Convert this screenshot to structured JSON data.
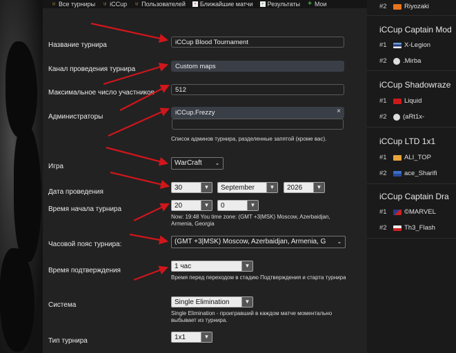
{
  "nav": [
    {
      "label": "Все турниры",
      "icon": "trophy-icon"
    },
    {
      "label": "iCCup",
      "icon": "trophy-icon"
    },
    {
      "label": "Пользователей",
      "icon": "trophy-icon"
    },
    {
      "label": "Ближайшие матчи",
      "icon": "calendar-icon"
    },
    {
      "label": "Результаты",
      "icon": "results-icon"
    },
    {
      "label": "Мои",
      "icon": "plus-icon"
    }
  ],
  "form": {
    "name_label": "Название турнира",
    "name_value": "iCCup Blood Tournament",
    "channel_label": "Канал проведения турнира",
    "channel_value": "Custom maps",
    "max_label": "Максимальное число участников",
    "max_value": "512",
    "admins_label": "Администраторы",
    "admin_tag": "iCCup.Frezzy",
    "admin_remove": "×",
    "admins_hint": "Список админов турнира, разделенные запятой (кроме вас).",
    "game_label": "Игра",
    "game_value": "WarCraft",
    "date_label": "Дата проведения",
    "date_day": "30",
    "date_month": "September",
    "date_year": "2026",
    "time_label": "Время начала турнира",
    "time_hour": "20",
    "time_min": "0",
    "time_hint": "Now: 19:48 You time zone: (GMT +3|MSK) Moscow, Azerbaidjan, Armenia, Georgia",
    "tz_label": "Часовой пояс турнира:",
    "tz_value": "(GMT +3|MSK) Moscow, Azerbaidjan, Armenia, G",
    "confirm_label": "Время подтверждения",
    "confirm_value": "1 час",
    "confirm_hint": "Время перед переходом в стадию Подтверждения и старта турнира",
    "system_label": "Система",
    "system_value": "Single Elimination",
    "system_hint": "Single Elimination - проигравший в каждом матче моментально выбывает из турнира.",
    "type_label": "Тип турнира",
    "type_value": "1x1"
  },
  "sidebar": [
    {
      "title": "",
      "rows": [
        {
          "rank": "#2",
          "name": "Riyozaki"
        }
      ]
    },
    {
      "title": "iCCup Captain Mod",
      "rows": [
        {
          "rank": "#1",
          "name": "X-Legion"
        },
        {
          "rank": "#2",
          "name": ".Mirba"
        }
      ]
    },
    {
      "title": "iCCup Shadowraze",
      "rows": [
        {
          "rank": "#1",
          "name": "Liquid"
        },
        {
          "rank": "#2",
          "name": "(aRt1x-"
        }
      ]
    },
    {
      "title": "iCCup LTD 1x1",
      "rows": [
        {
          "rank": "#1",
          "name": "ALI_TOP"
        },
        {
          "rank": "#2",
          "name": "ace_Sharifi"
        }
      ]
    },
    {
      "title": "iCCup Captain Dra",
      "rows": [
        {
          "rank": "#1",
          "name": "©MARVEL"
        },
        {
          "rank": "#2",
          "name": "Th3_Flash"
        }
      ]
    }
  ],
  "colors": {
    "arrow": "#d0161b",
    "field_filled": "#3a3f47",
    "panel": "#222222"
  }
}
